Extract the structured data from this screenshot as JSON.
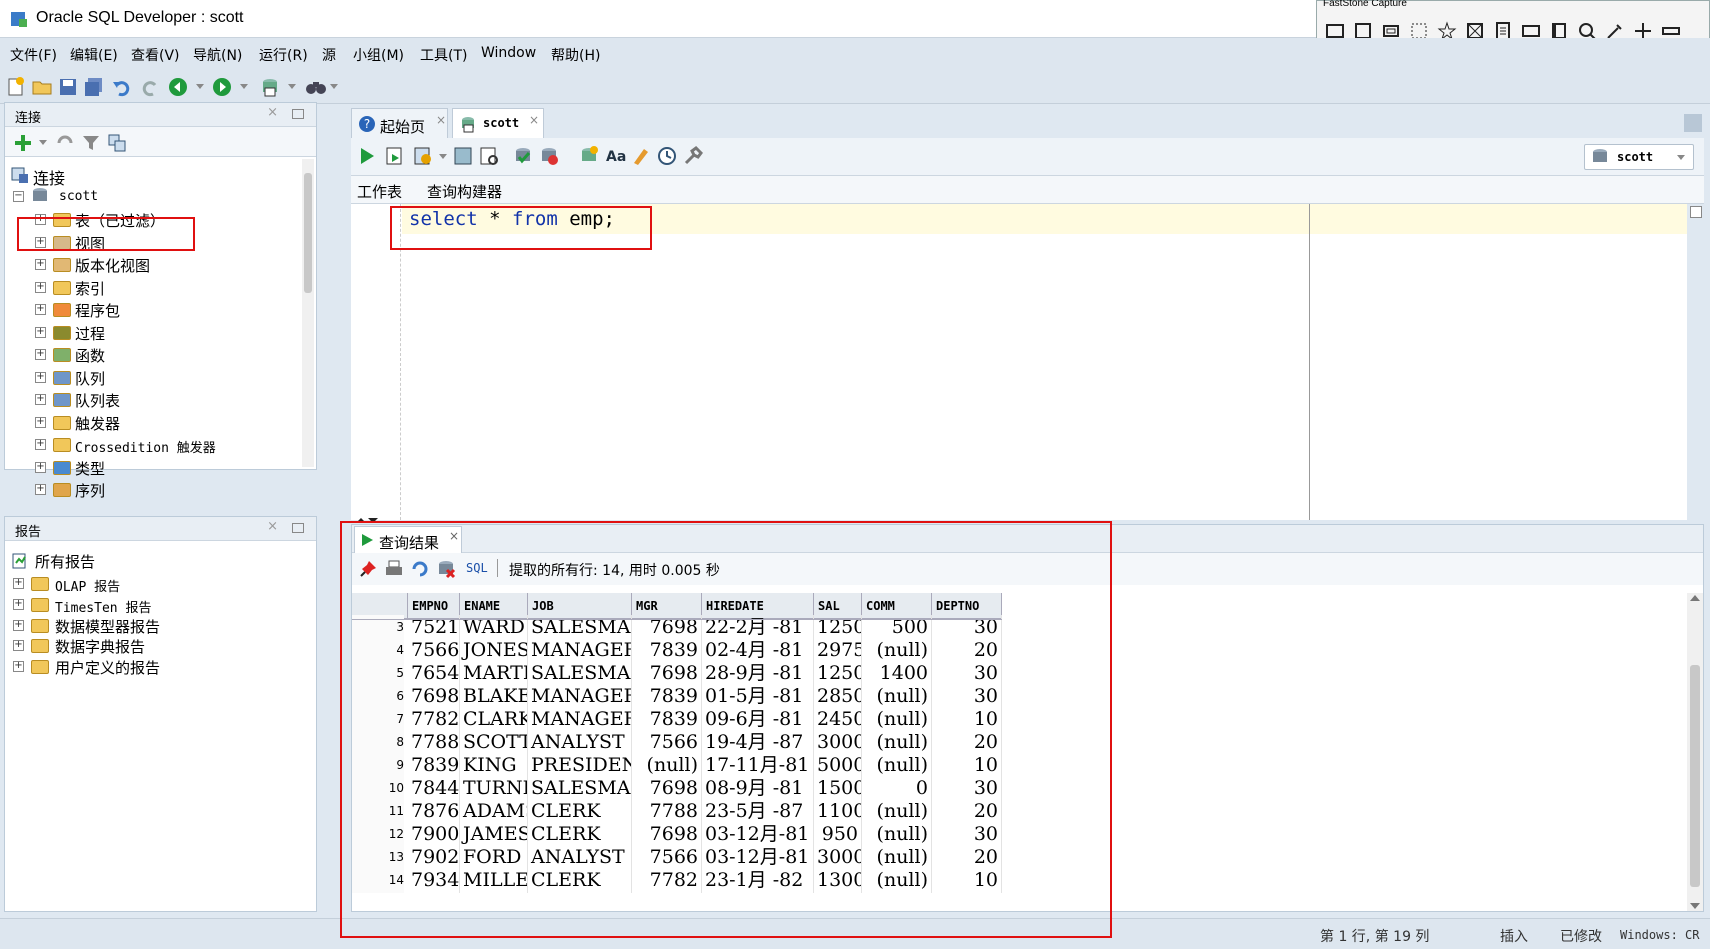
{
  "window": {
    "title": "Oracle SQL Developer : scott"
  },
  "faststone": {
    "title": "FastStone Capture"
  },
  "menu": [
    "文件(F)",
    "编辑(E)",
    "查看(V)",
    "导航(N)",
    "运行(R)",
    "源",
    "小组(M)",
    "工具(T)",
    "Window",
    "帮助(H)"
  ],
  "connections_panel": {
    "title": "连接",
    "root_label": "连接",
    "connection": "scott",
    "items": [
      "表（已过滤）",
      "视图",
      "版本化视图",
      "索引",
      "程序包",
      "过程",
      "函数",
      "队列",
      "队列表",
      "触发器",
      "Crossedition 触发器",
      "类型",
      "序列"
    ]
  },
  "reports_panel": {
    "title": "报告",
    "root_label": "所有报告",
    "items": [
      "OLAP 报告",
      "TimesTen 报告",
      "数据模型器报告",
      "数据字典报告",
      "用户定义的报告"
    ]
  },
  "doc_tabs": [
    {
      "label": "起始页"
    },
    {
      "label": "scott"
    }
  ],
  "connection_selector": "scott",
  "sub_tabs": [
    "工作表",
    "查询构建器"
  ],
  "editor": {
    "kw1": "select",
    "star": "*",
    "kw2": "from",
    "table": "emp;"
  },
  "results": {
    "tab_label": "查询结果",
    "sql_label": "SQL",
    "status_text": "提取的所有行: 14, 用时 0.005 秒",
    "columns": [
      "EMPNO",
      "ENAME",
      "JOB",
      "MGR",
      "HIREDATE",
      "SAL",
      "COMM",
      "DEPTNO"
    ],
    "rows": [
      [
        "3",
        "7521",
        "WARD",
        "SALESMAN",
        "7698",
        "22-2月 -81",
        "1250",
        "500",
        "30"
      ],
      [
        "4",
        "7566",
        "JONES",
        "MANAGER",
        "7839",
        "02-4月 -81",
        "2975",
        "(null)",
        "20"
      ],
      [
        "5",
        "7654",
        "MARTIN",
        "SALESMAN",
        "7698",
        "28-9月 -81",
        "1250",
        "1400",
        "30"
      ],
      [
        "6",
        "7698",
        "BLAKE",
        "MANAGER",
        "7839",
        "01-5月 -81",
        "2850",
        "(null)",
        "30"
      ],
      [
        "7",
        "7782",
        "CLARK",
        "MANAGER",
        "7839",
        "09-6月 -81",
        "2450",
        "(null)",
        "10"
      ],
      [
        "8",
        "7788",
        "SCOTT",
        "ANALYST",
        "7566",
        "19-4月 -87",
        "3000",
        "(null)",
        "20"
      ],
      [
        "9",
        "7839",
        "KING",
        "PRESIDENT",
        "(null)",
        "17-11月-81",
        "5000",
        "(null)",
        "10"
      ],
      [
        "10",
        "7844",
        "TURNER",
        "SALESMAN",
        "7698",
        "08-9月 -81",
        "1500",
        "0",
        "30"
      ],
      [
        "11",
        "7876",
        "ADAMS",
        "CLERK",
        "7788",
        "23-5月 -87",
        "1100",
        "(null)",
        "20"
      ],
      [
        "12",
        "7900",
        "JAMES",
        "CLERK",
        "7698",
        "03-12月-81",
        "950",
        "(null)",
        "30"
      ],
      [
        "13",
        "7902",
        "FORD",
        "ANALYST",
        "7566",
        "03-12月-81",
        "3000",
        "(null)",
        "20"
      ],
      [
        "14",
        "7934",
        "MILLER",
        "CLERK",
        "7782",
        "23-1月 -82",
        "1300",
        "(null)",
        "10"
      ]
    ]
  },
  "statusbar": {
    "position": "第 1 行, 第 19 列",
    "mode": "插入",
    "modified": "已修改",
    "os": "Windows: CR"
  }
}
